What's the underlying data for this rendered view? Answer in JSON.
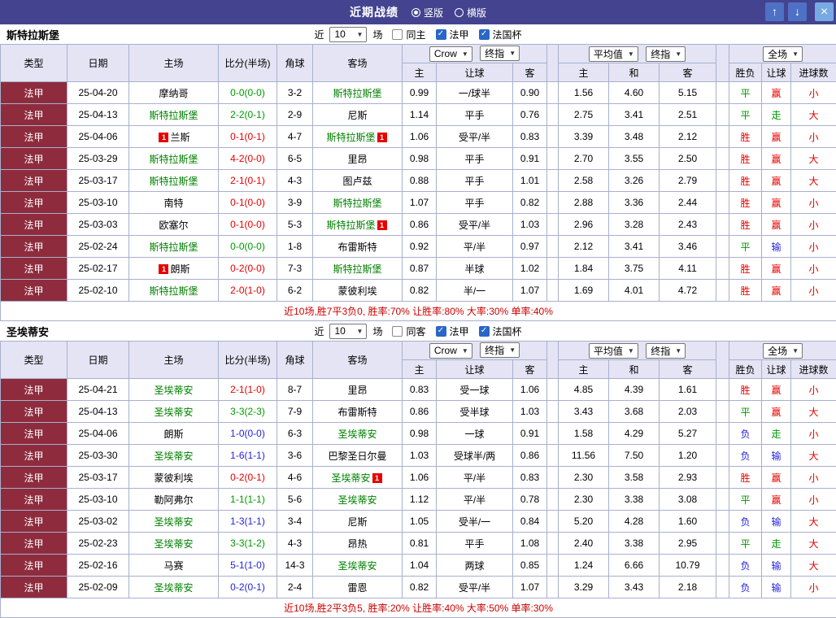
{
  "colors": {
    "titlebar_bg": "#434390",
    "btn_blue": "#4e71c5",
    "btn_close": "#77a9e3",
    "header_bg": "#e4e4f4",
    "border": "#a8b0ce",
    "league_bg": "#8e2c3e",
    "check_blue": "#2a66c8",
    "badge_bg": "#e60000",
    "focal": "#008000",
    "red": "#e60000",
    "green": "#009900",
    "blue": "#2323dd",
    "summary": "#cc0000"
  },
  "icons": {
    "up": "↑",
    "down": "↓",
    "close": "×",
    "check": "✓",
    "chevron_down": "▼"
  },
  "titlebar": {
    "title": "近期战绩",
    "vertical_label": "竖版",
    "horizontal_label": "横版"
  },
  "filter_labels": {
    "near": "近",
    "games": "场",
    "league": "法甲",
    "cup": "法国杯"
  },
  "table": {
    "headers": {
      "type": "类型",
      "date": "日期",
      "home": "主场",
      "score": "比分(半场)",
      "corner": "角球",
      "away": "客场",
      "odds_home": "主",
      "handicap": "让球",
      "odds_away": "客",
      "avg_home": "主",
      "avg_draw": "和",
      "avg_away": "客",
      "result": "胜负",
      "cover": "让球",
      "goals": "进球数"
    },
    "selects": {
      "bookmaker": "Crow",
      "final": "终指",
      "average": "平均值",
      "fulltime": "全场"
    }
  },
  "sections": [
    {
      "team": "斯特拉斯堡",
      "filter": {
        "count": "10",
        "same_label": "同主",
        "same_checked": false,
        "league_checked": true,
        "cup_checked": true
      },
      "rows": [
        {
          "league": "法甲",
          "date": "25-04-20",
          "home": "摩纳哥",
          "home_focal": false,
          "home_badge": "",
          "score": "0-0(0-0)",
          "score_color": "green",
          "corner": "3-2",
          "away": "斯特拉斯堡",
          "away_focal": true,
          "away_badge": "",
          "crown_home": "0.99",
          "crown_handicap": "一/球半",
          "crown_away": "0.90",
          "avg_home": "1.56",
          "avg_draw": "4.60",
          "avg_away": "5.15",
          "result": "平",
          "result_color": "green",
          "cover": "赢",
          "cover_color": "red",
          "goals": "小",
          "goals_color": "red"
        },
        {
          "league": "法甲",
          "date": "25-04-13",
          "home": "斯特拉斯堡",
          "home_focal": true,
          "home_badge": "",
          "score": "2-2(0-1)",
          "score_color": "green",
          "corner": "2-9",
          "away": "尼斯",
          "away_focal": false,
          "away_badge": "",
          "crown_home": "1.14",
          "crown_handicap": "平手",
          "crown_away": "0.76",
          "avg_home": "2.75",
          "avg_draw": "3.41",
          "avg_away": "2.51",
          "result": "平",
          "result_color": "green",
          "cover": "走",
          "cover_color": "green",
          "goals": "大",
          "goals_color": "red"
        },
        {
          "league": "法甲",
          "date": "25-04-06",
          "home": "兰斯",
          "home_focal": false,
          "home_badge": "1",
          "score": "0-1(0-1)",
          "score_color": "red",
          "corner": "4-7",
          "away": "斯特拉斯堡",
          "away_focal": true,
          "away_badge": "1",
          "crown_home": "1.06",
          "crown_handicap": "受平/半",
          "crown_away": "0.83",
          "avg_home": "3.39",
          "avg_draw": "3.48",
          "avg_away": "2.12",
          "result": "胜",
          "result_color": "red",
          "cover": "赢",
          "cover_color": "red",
          "goals": "小",
          "goals_color": "red"
        },
        {
          "league": "法甲",
          "date": "25-03-29",
          "home": "斯特拉斯堡",
          "home_focal": true,
          "home_badge": "",
          "score": "4-2(0-0)",
          "score_color": "red",
          "corner": "6-5",
          "away": "里昂",
          "away_focal": false,
          "away_badge": "",
          "crown_home": "0.98",
          "crown_handicap": "平手",
          "crown_away": "0.91",
          "avg_home": "2.70",
          "avg_draw": "3.55",
          "avg_away": "2.50",
          "result": "胜",
          "result_color": "red",
          "cover": "赢",
          "cover_color": "red",
          "goals": "大",
          "goals_color": "red"
        },
        {
          "league": "法甲",
          "date": "25-03-17",
          "home": "斯特拉斯堡",
          "home_focal": true,
          "home_badge": "",
          "score": "2-1(0-1)",
          "score_color": "red",
          "corner": "4-3",
          "away": "图卢兹",
          "away_focal": false,
          "away_badge": "",
          "crown_home": "0.88",
          "crown_handicap": "平手",
          "crown_away": "1.01",
          "avg_home": "2.58",
          "avg_draw": "3.26",
          "avg_away": "2.79",
          "result": "胜",
          "result_color": "red",
          "cover": "赢",
          "cover_color": "red",
          "goals": "大",
          "goals_color": "red"
        },
        {
          "league": "法甲",
          "date": "25-03-10",
          "home": "南特",
          "home_focal": false,
          "home_badge": "",
          "score": "0-1(0-0)",
          "score_color": "red",
          "corner": "3-9",
          "away": "斯特拉斯堡",
          "away_focal": true,
          "away_badge": "",
          "crown_home": "1.07",
          "crown_handicap": "平手",
          "crown_away": "0.82",
          "avg_home": "2.88",
          "avg_draw": "3.36",
          "avg_away": "2.44",
          "result": "胜",
          "result_color": "red",
          "cover": "赢",
          "cover_color": "red",
          "goals": "小",
          "goals_color": "red"
        },
        {
          "league": "法甲",
          "date": "25-03-03",
          "home": "欧塞尔",
          "home_focal": false,
          "home_badge": "",
          "score": "0-1(0-0)",
          "score_color": "red",
          "corner": "5-3",
          "away": "斯特拉斯堡",
          "away_focal": true,
          "away_badge": "1",
          "crown_home": "0.86",
          "crown_handicap": "受平/半",
          "crown_away": "1.03",
          "avg_home": "2.96",
          "avg_draw": "3.28",
          "avg_away": "2.43",
          "result": "胜",
          "result_color": "red",
          "cover": "赢",
          "cover_color": "red",
          "goals": "小",
          "goals_color": "red"
        },
        {
          "league": "法甲",
          "date": "25-02-24",
          "home": "斯特拉斯堡",
          "home_focal": true,
          "home_badge": "",
          "score": "0-0(0-0)",
          "score_color": "green",
          "corner": "1-8",
          "away": "布雷斯特",
          "away_focal": false,
          "away_badge": "",
          "crown_home": "0.92",
          "crown_handicap": "平/半",
          "crown_away": "0.97",
          "avg_home": "2.12",
          "avg_draw": "3.41",
          "avg_away": "3.46",
          "result": "平",
          "result_color": "green",
          "cover": "输",
          "cover_color": "blue",
          "goals": "小",
          "goals_color": "red"
        },
        {
          "league": "法甲",
          "date": "25-02-17",
          "home": "朗斯",
          "home_focal": false,
          "home_badge": "1",
          "score": "0-2(0-0)",
          "score_color": "red",
          "corner": "7-3",
          "away": "斯特拉斯堡",
          "away_focal": true,
          "away_badge": "",
          "crown_home": "0.87",
          "crown_handicap": "半球",
          "crown_away": "1.02",
          "avg_home": "1.84",
          "avg_draw": "3.75",
          "avg_away": "4.11",
          "result": "胜",
          "result_color": "red",
          "cover": "赢",
          "cover_color": "red",
          "goals": "小",
          "goals_color": "red"
        },
        {
          "league": "法甲",
          "date": "25-02-10",
          "home": "斯特拉斯堡",
          "home_focal": true,
          "home_badge": "",
          "score": "2-0(1-0)",
          "score_color": "red",
          "corner": "6-2",
          "away": "蒙彼利埃",
          "away_focal": false,
          "away_badge": "",
          "crown_home": "0.82",
          "crown_handicap": "半/一",
          "crown_away": "1.07",
          "avg_home": "1.69",
          "avg_draw": "4.01",
          "avg_away": "4.72",
          "result": "胜",
          "result_color": "red",
          "cover": "赢",
          "cover_color": "red",
          "goals": "小",
          "goals_color": "red"
        }
      ],
      "summary": "近10场,胜7平3负0, 胜率:70% 让胜率:80% 大率:30% 单率:40%"
    },
    {
      "team": "圣埃蒂安",
      "filter": {
        "count": "10",
        "same_label": "同客",
        "same_checked": false,
        "league_checked": true,
        "cup_checked": true
      },
      "rows": [
        {
          "league": "法甲",
          "date": "25-04-21",
          "home": "圣埃蒂安",
          "home_focal": true,
          "home_badge": "",
          "score": "2-1(1-0)",
          "score_color": "red",
          "corner": "8-7",
          "away": "里昂",
          "away_focal": false,
          "away_badge": "",
          "crown_home": "0.83",
          "crown_handicap": "受一球",
          "crown_away": "1.06",
          "avg_home": "4.85",
          "avg_draw": "4.39",
          "avg_away": "1.61",
          "result": "胜",
          "result_color": "red",
          "cover": "赢",
          "cover_color": "red",
          "goals": "小",
          "goals_color": "red"
        },
        {
          "league": "法甲",
          "date": "25-04-13",
          "home": "圣埃蒂安",
          "home_focal": true,
          "home_badge": "",
          "score": "3-3(2-3)",
          "score_color": "green",
          "corner": "7-9",
          "away": "布雷斯特",
          "away_focal": false,
          "away_badge": "",
          "crown_home": "0.86",
          "crown_handicap": "受半球",
          "crown_away": "1.03",
          "avg_home": "3.43",
          "avg_draw": "3.68",
          "avg_away": "2.03",
          "result": "平",
          "result_color": "green",
          "cover": "赢",
          "cover_color": "red",
          "goals": "大",
          "goals_color": "red"
        },
        {
          "league": "法甲",
          "date": "25-04-06",
          "home": "朗斯",
          "home_focal": false,
          "home_badge": "",
          "score": "1-0(0-0)",
          "score_color": "blue",
          "corner": "6-3",
          "away": "圣埃蒂安",
          "away_focal": true,
          "away_badge": "",
          "crown_home": "0.98",
          "crown_handicap": "一球",
          "crown_away": "0.91",
          "avg_home": "1.58",
          "avg_draw": "4.29",
          "avg_away": "5.27",
          "result": "负",
          "result_color": "blue",
          "cover": "走",
          "cover_color": "green",
          "goals": "小",
          "goals_color": "red"
        },
        {
          "league": "法甲",
          "date": "25-03-30",
          "home": "圣埃蒂安",
          "home_focal": true,
          "home_badge": "",
          "score": "1-6(1-1)",
          "score_color": "blue",
          "corner": "3-6",
          "away": "巴黎圣日尔曼",
          "away_focal": false,
          "away_badge": "",
          "crown_home": "1.03",
          "crown_handicap": "受球半/两",
          "crown_away": "0.86",
          "avg_home": "11.56",
          "avg_draw": "7.50",
          "avg_away": "1.20",
          "result": "负",
          "result_color": "blue",
          "cover": "输",
          "cover_color": "blue",
          "goals": "大",
          "goals_color": "red"
        },
        {
          "league": "法甲",
          "date": "25-03-17",
          "home": "蒙彼利埃",
          "home_focal": false,
          "home_badge": "",
          "score": "0-2(0-1)",
          "score_color": "red",
          "corner": "4-6",
          "away": "圣埃蒂安",
          "away_focal": true,
          "away_badge": "1",
          "crown_home": "1.06",
          "crown_handicap": "平/半",
          "crown_away": "0.83",
          "avg_home": "2.30",
          "avg_draw": "3.58",
          "avg_away": "2.93",
          "result": "胜",
          "result_color": "red",
          "cover": "赢",
          "cover_color": "red",
          "goals": "小",
          "goals_color": "red"
        },
        {
          "league": "法甲",
          "date": "25-03-10",
          "home": "勒阿弗尔",
          "home_focal": false,
          "home_badge": "",
          "score": "1-1(1-1)",
          "score_color": "green",
          "corner": "5-6",
          "away": "圣埃蒂安",
          "away_focal": true,
          "away_badge": "",
          "crown_home": "1.12",
          "crown_handicap": "平/半",
          "crown_away": "0.78",
          "avg_home": "2.30",
          "avg_draw": "3.38",
          "avg_away": "3.08",
          "result": "平",
          "result_color": "green",
          "cover": "赢",
          "cover_color": "red",
          "goals": "小",
          "goals_color": "red"
        },
        {
          "league": "法甲",
          "date": "25-03-02",
          "home": "圣埃蒂安",
          "home_focal": true,
          "home_badge": "",
          "score": "1-3(1-1)",
          "score_color": "blue",
          "corner": "3-4",
          "away": "尼斯",
          "away_focal": false,
          "away_badge": "",
          "crown_home": "1.05",
          "crown_handicap": "受半/一",
          "crown_away": "0.84",
          "avg_home": "5.20",
          "avg_draw": "4.28",
          "avg_away": "1.60",
          "result": "负",
          "result_color": "blue",
          "cover": "输",
          "cover_color": "blue",
          "goals": "大",
          "goals_color": "red"
        },
        {
          "league": "法甲",
          "date": "25-02-23",
          "home": "圣埃蒂安",
          "home_focal": true,
          "home_badge": "",
          "score": "3-3(1-2)",
          "score_color": "green",
          "corner": "4-3",
          "away": "昂热",
          "away_focal": false,
          "away_badge": "",
          "crown_home": "0.81",
          "crown_handicap": "平手",
          "crown_away": "1.08",
          "avg_home": "2.40",
          "avg_draw": "3.38",
          "avg_away": "2.95",
          "result": "平",
          "result_color": "green",
          "cover": "走",
          "cover_color": "green",
          "goals": "大",
          "goals_color": "red"
        },
        {
          "league": "法甲",
          "date": "25-02-16",
          "home": "马赛",
          "home_focal": false,
          "home_badge": "",
          "score": "5-1(1-0)",
          "score_color": "blue",
          "corner": "14-3",
          "away": "圣埃蒂安",
          "away_focal": true,
          "away_badge": "",
          "crown_home": "1.04",
          "crown_handicap": "两球",
          "crown_away": "0.85",
          "avg_home": "1.24",
          "avg_draw": "6.66",
          "avg_away": "10.79",
          "result": "负",
          "result_color": "blue",
          "cover": "输",
          "cover_color": "blue",
          "goals": "大",
          "goals_color": "red"
        },
        {
          "league": "法甲",
          "date": "25-02-09",
          "home": "圣埃蒂安",
          "home_focal": true,
          "home_badge": "",
          "score": "0-2(0-1)",
          "score_color": "blue",
          "corner": "2-4",
          "away": "雷恩",
          "away_focal": false,
          "away_badge": "",
          "crown_home": "0.82",
          "crown_handicap": "受平/半",
          "crown_away": "1.07",
          "avg_home": "3.29",
          "avg_draw": "3.43",
          "avg_away": "2.18",
          "result": "负",
          "result_color": "blue",
          "cover": "输",
          "cover_color": "blue",
          "goals": "小",
          "goals_color": "red"
        }
      ],
      "summary": "近10场,胜2平3负5, 胜率:20% 让胜率:40% 大率:50% 单率:30%"
    }
  ]
}
